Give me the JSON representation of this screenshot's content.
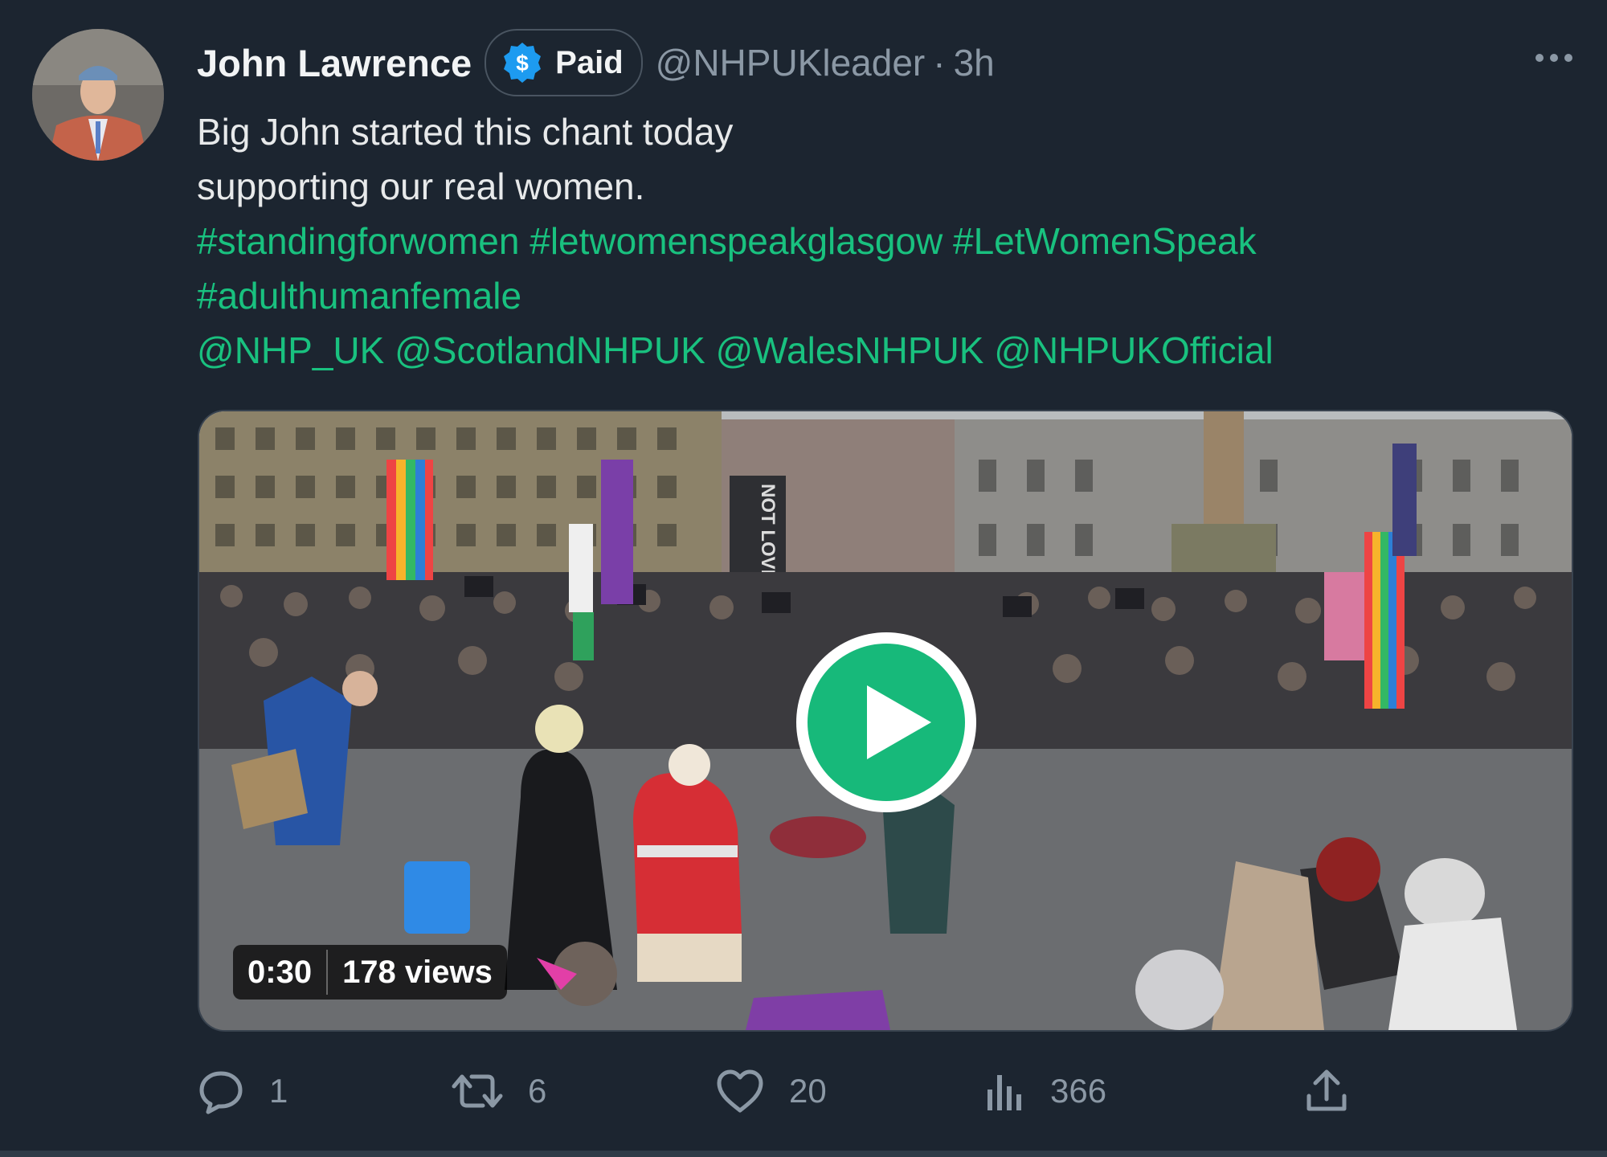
{
  "author": {
    "name": "John Lawrence",
    "badge": "Paid",
    "handle": "@NHPUKleader",
    "separator": "·",
    "time": "3h"
  },
  "tweet": {
    "line1": "Big John started this chant today",
    "line2": "supporting our real women.",
    "hashtags_line1": [
      "#standingforwomen",
      "#letwomenspeakglasgow",
      "#LetWomenSpeak"
    ],
    "hashtags_line2": [
      "#adulthumanfemale"
    ],
    "mentions": [
      "@NHP_UK",
      "@ScotlandNHPUK",
      "@WalesNHPUK",
      "@NHPUKOfficial"
    ]
  },
  "video": {
    "duration": "0:30",
    "views": "178 views",
    "banner_text": "NOT LOVE"
  },
  "actions": {
    "replies": "1",
    "reposts": "6",
    "likes": "20",
    "views": "366"
  },
  "colors": {
    "background": "#1c2530",
    "accent": "#19c17f",
    "muted": "#8b98a5",
    "badge_icon": "#1d9bf0",
    "play_button": "#17b97a"
  },
  "icons": {
    "more": "more-icon",
    "badge": "dollar-icon",
    "play": "play-icon",
    "reply": "reply-icon",
    "repost": "repost-icon",
    "like": "like-icon",
    "analytics": "analytics-icon",
    "share": "share-icon"
  }
}
